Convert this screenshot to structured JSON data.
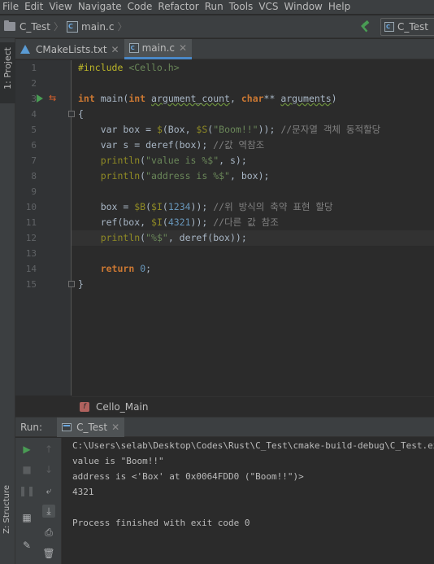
{
  "menu": [
    "File",
    "Edit",
    "View",
    "Navigate",
    "Code",
    "Refactor",
    "Run",
    "Tools",
    "VCS",
    "Window",
    "Help"
  ],
  "navbar": {
    "project": "C_Test",
    "file": "main.c",
    "run_config": "C_Test"
  },
  "left_tabs": {
    "project": "1: Project",
    "structure": "Z: Structure"
  },
  "editor_tabs": [
    {
      "label": "CMakeLists.txt",
      "active": false
    },
    {
      "label": "main.c",
      "active": true
    }
  ],
  "line_numbers": [
    "1",
    "2",
    "3",
    "4",
    "5",
    "6",
    "7",
    "8",
    "9",
    "10",
    "11",
    "12",
    "13",
    "14",
    "15"
  ],
  "code": {
    "l1_inc": "#include",
    "l1_file": " <Cello.h>",
    "l3_int": "int",
    "l3_fn": " main(",
    "l3_int2": "int",
    "l3_arg1": "argument_count",
    "l3_comma": ", ",
    "l3_char": "char",
    "l3_ptr": "** ",
    "l3_arg2": "arguments",
    "l3_close": ")",
    "l4": "{",
    "l5_a": "    var box = ",
    "l5_b": "$",
    "l5_c": "(Box, ",
    "l5_d": "$S",
    "l5_e": "(",
    "l5_f": "\"Boom!!\"",
    "l5_g": ")); ",
    "l5_cmt": "//문자열 객체 동적할당",
    "l6_a": "    var s = deref(box); ",
    "l6_cmt": "//값 역참조",
    "l7_a": "    ",
    "l7_b": "println",
    "l7_c": "(",
    "l7_d": "\"value is %$\"",
    "l7_e": ", s);",
    "l8_a": "    ",
    "l8_b": "println",
    "l8_c": "(",
    "l8_d": "\"address is %$\"",
    "l8_e": ", box);",
    "l10_a": "    box = ",
    "l10_b": "$B",
    "l10_c": "(",
    "l10_d": "$I",
    "l10_e": "(",
    "l10_f": "1234",
    "l10_g": ")); ",
    "l10_cmt": "//위 방식의 축약 표현 할당",
    "l11_a": "    ref(box, ",
    "l11_b": "$I",
    "l11_c": "(",
    "l11_d": "4321",
    "l11_e": ")); ",
    "l11_cmt": "//다른 값 참조",
    "l12_a": "    ",
    "l12_b": "println",
    "l12_c": "(",
    "l12_d": "\"%$\"",
    "l12_e": ", deref(box));",
    "l14_a": "    ",
    "l14_b": "return",
    "l14_c": " ",
    "l14_d": "0",
    "l14_e": ";",
    "l15": "}"
  },
  "editor_breadcrumb": "Cello_Main",
  "run_panel": {
    "label": "Run:",
    "tab": "C_Test",
    "output": [
      "C:\\Users\\selab\\Desktop\\Codes\\Rust\\C_Test\\cmake-build-debug\\C_Test.exe",
      "value is \"Boom!!\"",
      "address is <'Box' at 0x0064FDD0 (\"Boom!!\")>",
      "4321",
      "",
      "Process finished with exit code 0"
    ]
  },
  "colors": {
    "keyword": "#cc7832",
    "string": "#6a8759",
    "number": "#6897bb",
    "comment": "#808080",
    "accent": "#4a88c7"
  }
}
